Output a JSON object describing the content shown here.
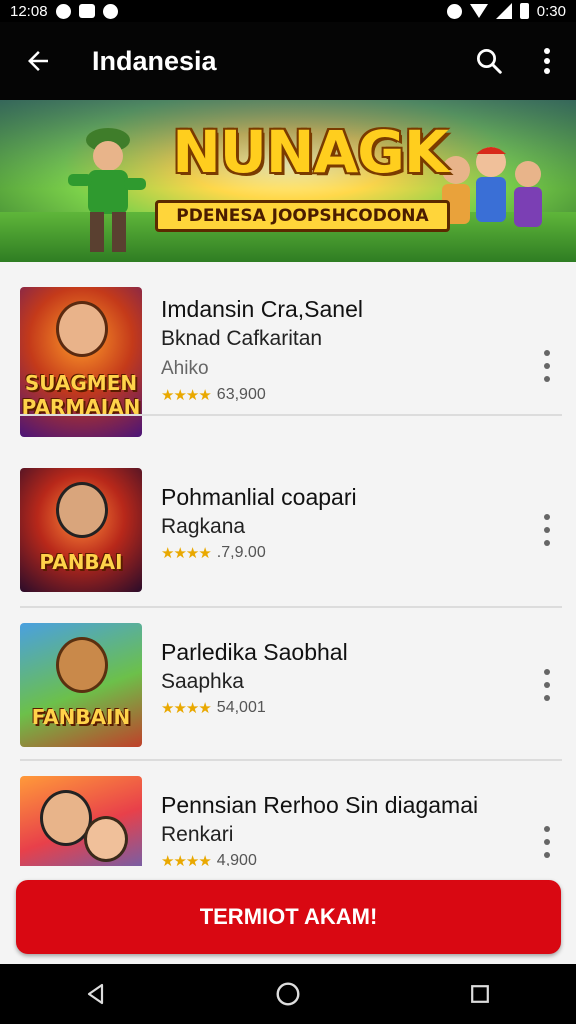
{
  "status_bar": {
    "time": "12:08",
    "time_right": "0:30"
  },
  "app_bar": {
    "title": "Indanesia"
  },
  "banner": {
    "title": "NUNAGK",
    "subtitle": "PDENESA JOOPSHCODONA"
  },
  "items": [
    {
      "title": "Imdansin Cra,Sanel",
      "line2": "Bknad Cafkaritan",
      "line3": "Ahiko",
      "rating": "63,900",
      "thumb_text": "SUAGMEN PARMAIAN"
    },
    {
      "title": "Pohmanlial coapari",
      "line2": "Ragkana",
      "line3": "",
      "rating": ".7,9.00",
      "thumb_text": "PANBAI"
    },
    {
      "title": "Parledika Saobhal",
      "line2": "Saaphka",
      "line3": "",
      "rating": "54,001",
      "thumb_text": "FANBAIN"
    },
    {
      "title": "Pennsian Rerhoo Sin diagamai",
      "line2": "Renkari",
      "line3": "",
      "rating": "4,900",
      "thumb_text": ""
    }
  ],
  "cta": {
    "label": "TERMIOT AKAM!"
  },
  "colors": {
    "accent": "#d90812",
    "appbar": "#050505",
    "star": "#e9a800"
  }
}
